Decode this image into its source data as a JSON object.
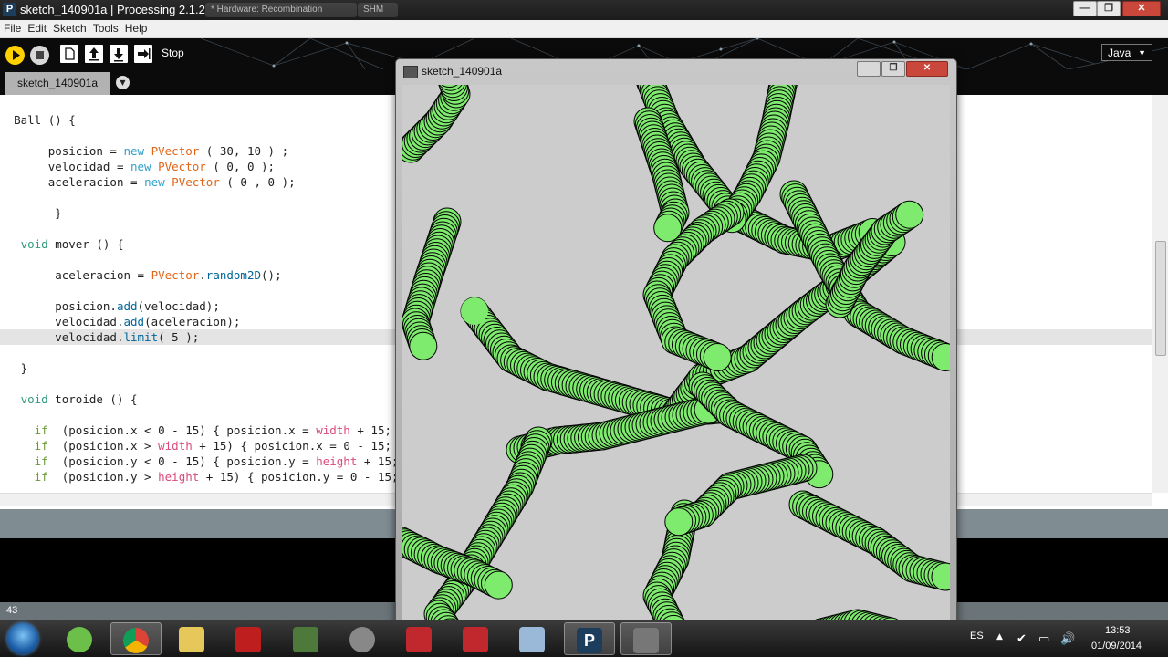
{
  "window": {
    "title": "sketch_140901a | Processing 2.1.2",
    "app_icon": "P",
    "ghost_tabs": [
      "* Hardware: Recombination",
      "SHM"
    ],
    "minimize": "—",
    "maximize": "❐",
    "close": "✕"
  },
  "menu": {
    "items": [
      "File",
      "Edit",
      "Sketch",
      "Tools",
      "Help"
    ]
  },
  "toolbar": {
    "run_icon": "play-icon",
    "stop_icon": "stop-icon",
    "new_icon": "new-document-icon",
    "open_icon": "open-arrow-up-icon",
    "save_icon": "save-arrow-down-icon",
    "export_icon": "export-icon",
    "status_label": "Stop",
    "mode": "Java",
    "mode_arrow": "▼"
  },
  "tabs": {
    "active": "sketch_140901a",
    "menu_arrow": "▼"
  },
  "editor": {
    "lines": [
      "Ball () {",
      "",
      "     posicion = new PVector ( 30, 10 ) ;",
      "     velocidad = new PVector ( 0, 0 );",
      "     aceleracion = new PVector ( 0 , 0 );",
      "",
      "      }",
      "",
      " void mover () {",
      "",
      "      aceleracion = PVector.random2D();",
      "",
      "      posicion.add(velocidad);",
      "      velocidad.add(aceleracion);",
      "      velocidad.limit( 5 );",
      "",
      " }",
      "",
      " void toroide () {",
      "",
      "   if  (posicion.x < 0 - 15) { posicion.x = width + 15; }",
      "   if  (posicion.x > width + 15) { posicion.x = 0 - 15; }",
      "   if  (posicion.y < 0 - 15) { posicion.y = height + 15; }",
      "   if  (posicion.y > height + 15) { posicion.y = 0 - 15; }"
    ],
    "highlighted_line": 14
  },
  "status": {
    "line_number": "43"
  },
  "sketch_window": {
    "title": "sketch_140901a",
    "minimize": "—",
    "maximize": "❐",
    "close": "✕",
    "background": "#cccccc",
    "ball_fill": "#7eea6e",
    "ball_stroke": "#000000"
  },
  "taskbar": {
    "language": "ES",
    "time": "13:53",
    "date": "01/09/2014",
    "apps": [
      "dreamweaver-icon",
      "chrome-icon",
      "file-manager-icon",
      "filezilla-icon",
      "monitor-icon",
      "audio-icon",
      "autocad-icon",
      "autocad-icon",
      "calculator-icon",
      "processing-icon",
      "sketch-window-icon"
    ]
  }
}
